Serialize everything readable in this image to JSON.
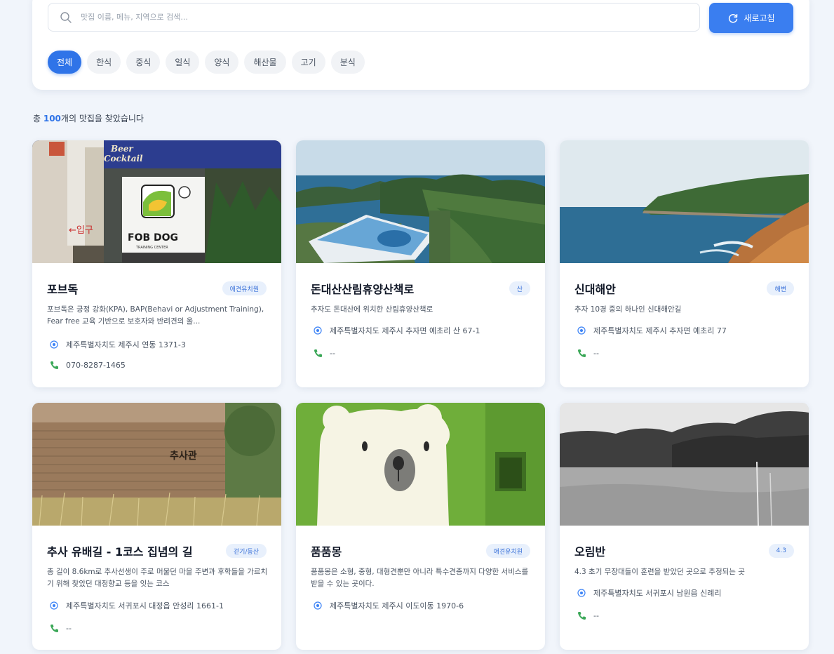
{
  "search": {
    "placeholder": "맛집 이름, 메뉴, 지역으로 검색...",
    "refresh_label": "새로고침"
  },
  "categories": [
    "전체",
    "한식",
    "중식",
    "일식",
    "양식",
    "해산물",
    "고기",
    "분식"
  ],
  "active_category": "전체",
  "result": {
    "prefix": "총 ",
    "count": "100",
    "suffix": "개의 맛집을 찾았습니다"
  },
  "cards": [
    {
      "title": "포브독",
      "badge": "애견유치원",
      "description": "포브독은 긍정 강화(KPA), BAP(Behavi or Adjustment Training), Fear free 교육 기반으로 보호자와 반려견의 올...",
      "address": "제주특별자치도 제주시 연동 1371-3",
      "phone": "070-8287-1465",
      "image_text": [
        "Beer",
        "Cocktail",
        "FOB DOG",
        "TRAINING CENTER",
        "←입구"
      ]
    },
    {
      "title": "돈대산산림휴양산책로",
      "badge": "산",
      "description": "추자도 돈대산에 위치한 산림휴양산책로",
      "address": "제주특별자치도 제주시 추자면 예초리 산 67-1",
      "phone": "--"
    },
    {
      "title": "신대해안",
      "badge": "해변",
      "description": "추자 10경 중의 하나인 신대해안길",
      "address": "제주특별자치도 제주시 추자면 예초리 77",
      "phone": "--"
    },
    {
      "title": "추사 유배길 - 1코스 집념의 길",
      "badge": "걷기/등산",
      "description": "총 길이 8.6km로 추사선생이 주로 머물던 마을 주변과 후학들을 가르치기 위해 찾았던 대정향교 등을 잇는 코스",
      "address": "제주특별자치도 서귀포시 대정읍 안성리 1661-1",
      "phone": "--",
      "image_text": [
        "추사관"
      ]
    },
    {
      "title": "품품몽",
      "badge": "애견유치원",
      "description": "품품몽은 소형, 중형, 대형견뿐만 아니라 특수견종까지 다양한 서비스를 받을 수 있는 곳이다.",
      "address": "제주특별자치도 제주시 이도이동 1970-6"
    },
    {
      "title": "오림반",
      "badge": "4.3",
      "description": "4.3 초기 무장대들이 훈련을 받았던 곳으로 추정되는 곳",
      "address": "제주특별자치도 서귀포시 남원읍 신례리",
      "phone": "--"
    }
  ],
  "colors": {
    "accent": "#2f74e8",
    "background": "#f1f5fb",
    "badge_bg": "#e8f0fc",
    "phone_icon": "#3aa757"
  },
  "icons": {
    "search": "search-icon",
    "refresh": "refresh-icon",
    "location": "location-pin-icon",
    "phone": "phone-icon"
  }
}
